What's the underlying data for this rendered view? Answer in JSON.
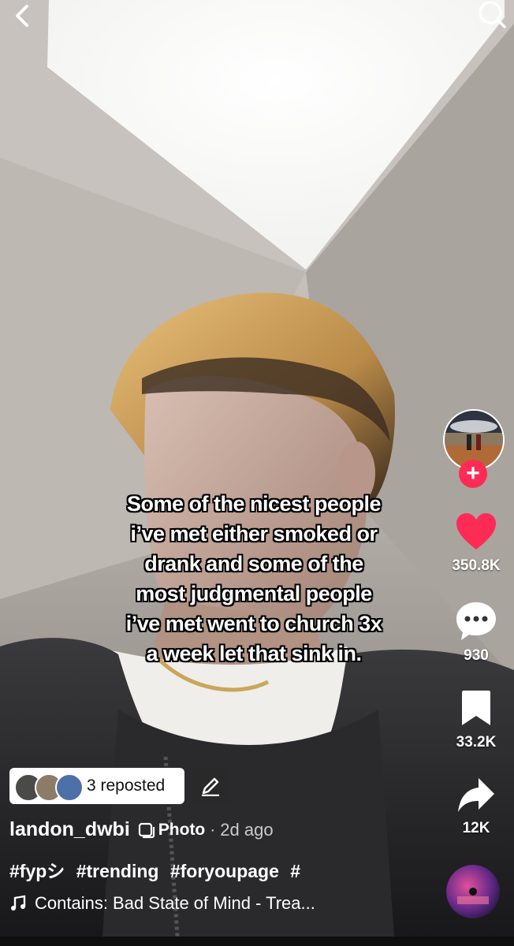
{
  "caption": {
    "lines": [
      "Some of the nicest people",
      "i’ve met either smoked or",
      "drank and some of the",
      "most judgmental people",
      "i’ve met went to church 3x",
      "a week let that sink in."
    ]
  },
  "actions": {
    "likes": "350.8K",
    "comments": "930",
    "saves": "33.2K",
    "shares": "12K"
  },
  "repost": {
    "label": "3 reposted"
  },
  "post": {
    "username": "landon_dwbi",
    "type_label": "Photo",
    "separator": "·",
    "time_ago": "2d ago",
    "hashtags": [
      "#fypシ",
      "#trending",
      "#foryoupage",
      "#"
    ],
    "music": "Contains: Bad State of Mind - Trea..."
  },
  "colors": {
    "accent": "#fe2c55",
    "like": "#fe2c55",
    "text": "#ffffff"
  },
  "icons": {
    "back": "chevron-left-icon",
    "search": "search-icon",
    "like": "heart-icon",
    "comment": "comment-bubble-icon",
    "save": "bookmark-icon",
    "share": "share-arrow-icon",
    "edit": "pencil-icon",
    "music": "music-note-icon",
    "photo": "photo-icon"
  }
}
